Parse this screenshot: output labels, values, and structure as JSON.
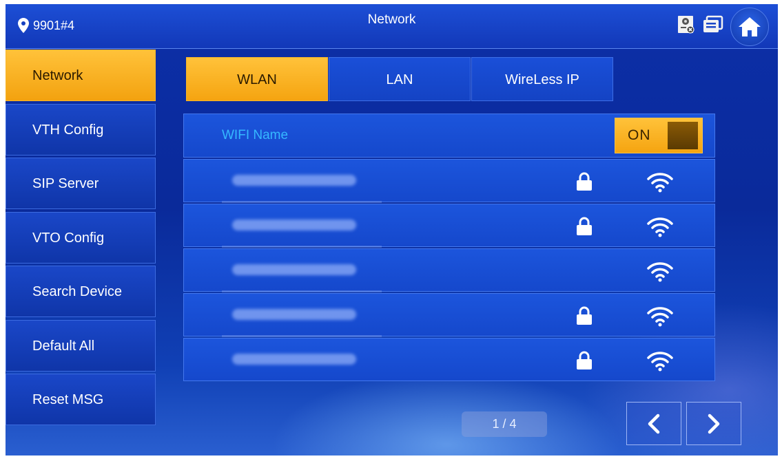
{
  "header": {
    "location": "9901#4",
    "title": "Network"
  },
  "sidebar": {
    "items": [
      {
        "label": "Network",
        "active": true
      },
      {
        "label": "VTH Config",
        "active": false
      },
      {
        "label": "SIP Server",
        "active": false
      },
      {
        "label": "VTO Config",
        "active": false
      },
      {
        "label": "Search Device",
        "active": false
      },
      {
        "label": "Default All",
        "active": false
      },
      {
        "label": "Reset MSG",
        "active": false
      }
    ]
  },
  "tabs": [
    {
      "label": "WLAN",
      "active": true
    },
    {
      "label": "LAN",
      "active": false
    },
    {
      "label": "WireLess IP",
      "active": false
    }
  ],
  "wifi": {
    "title": "WIFI Name",
    "toggle_label": "ON",
    "networks": [
      {
        "locked": true,
        "signal": "wifi-icon"
      },
      {
        "locked": true,
        "signal": "wifi-icon"
      },
      {
        "locked": false,
        "signal": "wifi-icon"
      },
      {
        "locked": true,
        "signal": "wifi-icon"
      },
      {
        "locked": true,
        "signal": "wifi-icon"
      }
    ]
  },
  "pager": {
    "text": "1 / 4"
  },
  "colors": {
    "accent": "#f5a410",
    "background": "#0c2fa8",
    "wifi_title": "#35b8ff"
  }
}
